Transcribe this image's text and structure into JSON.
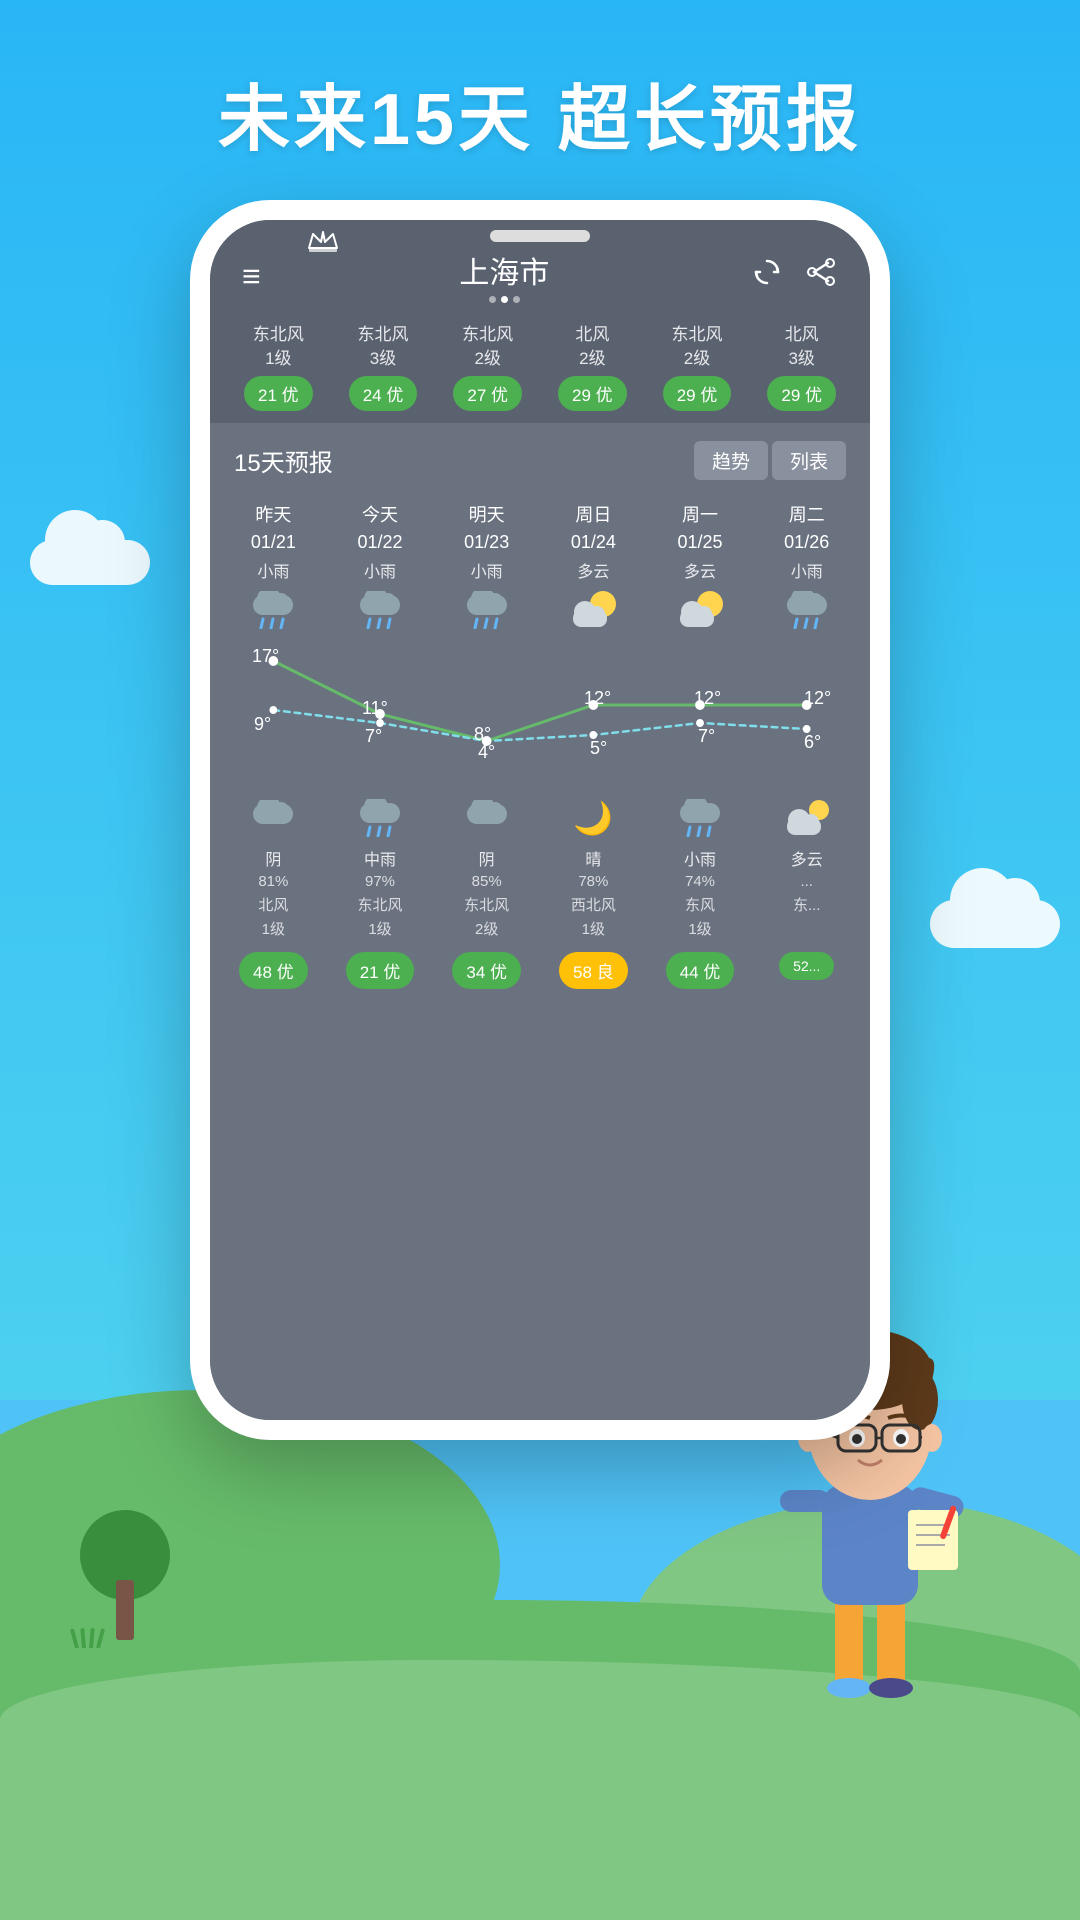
{
  "background": {
    "sky_color": "#29b6f6",
    "ground_color": "#66bb6a"
  },
  "hero": {
    "title": "未来15天  超长预报"
  },
  "app": {
    "city": "上海市",
    "header_icons": {
      "menu": "≡",
      "crown": "♛",
      "refresh": "↻",
      "share": "↗"
    },
    "dots": [
      "",
      "",
      ""
    ],
    "active_dot": 1
  },
  "aqi_top_row": [
    {
      "wind": "东北风\n1级",
      "aqi": "21 优",
      "color": "green"
    },
    {
      "wind": "东北风\n3级",
      "aqi": "24 优",
      "color": "green"
    },
    {
      "wind": "东北风\n2级",
      "aqi": "27 优",
      "color": "green"
    },
    {
      "wind": "北风\n2级",
      "aqi": "29 优",
      "color": "green"
    },
    {
      "wind": "东北风\n2级",
      "aqi": "29 优",
      "color": "green"
    },
    {
      "wind": "北风\n3级",
      "aqi": "29 优",
      "color": "green"
    }
  ],
  "forecast_section": {
    "title": "15天预报",
    "tabs": [
      "趋势",
      "列表"
    ]
  },
  "days": [
    {
      "label": "昨天\n01/21",
      "condition": "小雨",
      "icon": "rain",
      "high": "17°",
      "low": "9°"
    },
    {
      "label": "今天\n01/22",
      "condition": "小雨",
      "icon": "rain",
      "high": "11°",
      "low": "7°"
    },
    {
      "label": "明天\n01/23",
      "condition": "小雨",
      "icon": "rain",
      "high": "8°",
      "low": "4°"
    },
    {
      "label": "周日\n01/24",
      "condition": "多云",
      "icon": "partly",
      "high": "12°",
      "low": "5°"
    },
    {
      "label": "周一\n01/25",
      "condition": "多云",
      "icon": "partly",
      "high": "12°",
      "low": "7°"
    },
    {
      "label": "周二\n01/26",
      "condition": "小雨",
      "icon": "rain",
      "high": "12°",
      "low": "6°"
    }
  ],
  "night_rows": [
    {
      "icon": "cloud",
      "condition": "阴",
      "percent": "81%",
      "wind": "北风\n1级"
    },
    {
      "icon": "rain",
      "condition": "中雨",
      "percent": "97%",
      "wind": "东北风\n1级"
    },
    {
      "icon": "cloud",
      "condition": "阴",
      "percent": "85%",
      "wind": "东北风\n2级"
    },
    {
      "icon": "moon",
      "condition": "晴",
      "percent": "78%",
      "wind": "西北风\n1级"
    },
    {
      "icon": "rain",
      "condition": "小雨",
      "percent": "74%",
      "wind": "东风\n1级"
    },
    {
      "icon": "cloud",
      "condition": "多云",
      "percent": "...",
      "wind": "东..."
    }
  ],
  "bottom_aqi": [
    {
      "value": "48 优",
      "color": "green"
    },
    {
      "value": "21 优",
      "color": "green"
    },
    {
      "value": "34 优",
      "color": "green"
    },
    {
      "value": "58 良",
      "color": "yellow"
    },
    {
      "value": "44 优",
      "color": "green"
    },
    {
      "value": "52...",
      "color": "green"
    }
  ],
  "chart": {
    "high_temps": [
      17,
      11,
      8,
      12,
      12,
      12
    ],
    "low_temps": [
      9,
      7,
      4,
      5,
      7,
      6
    ]
  }
}
